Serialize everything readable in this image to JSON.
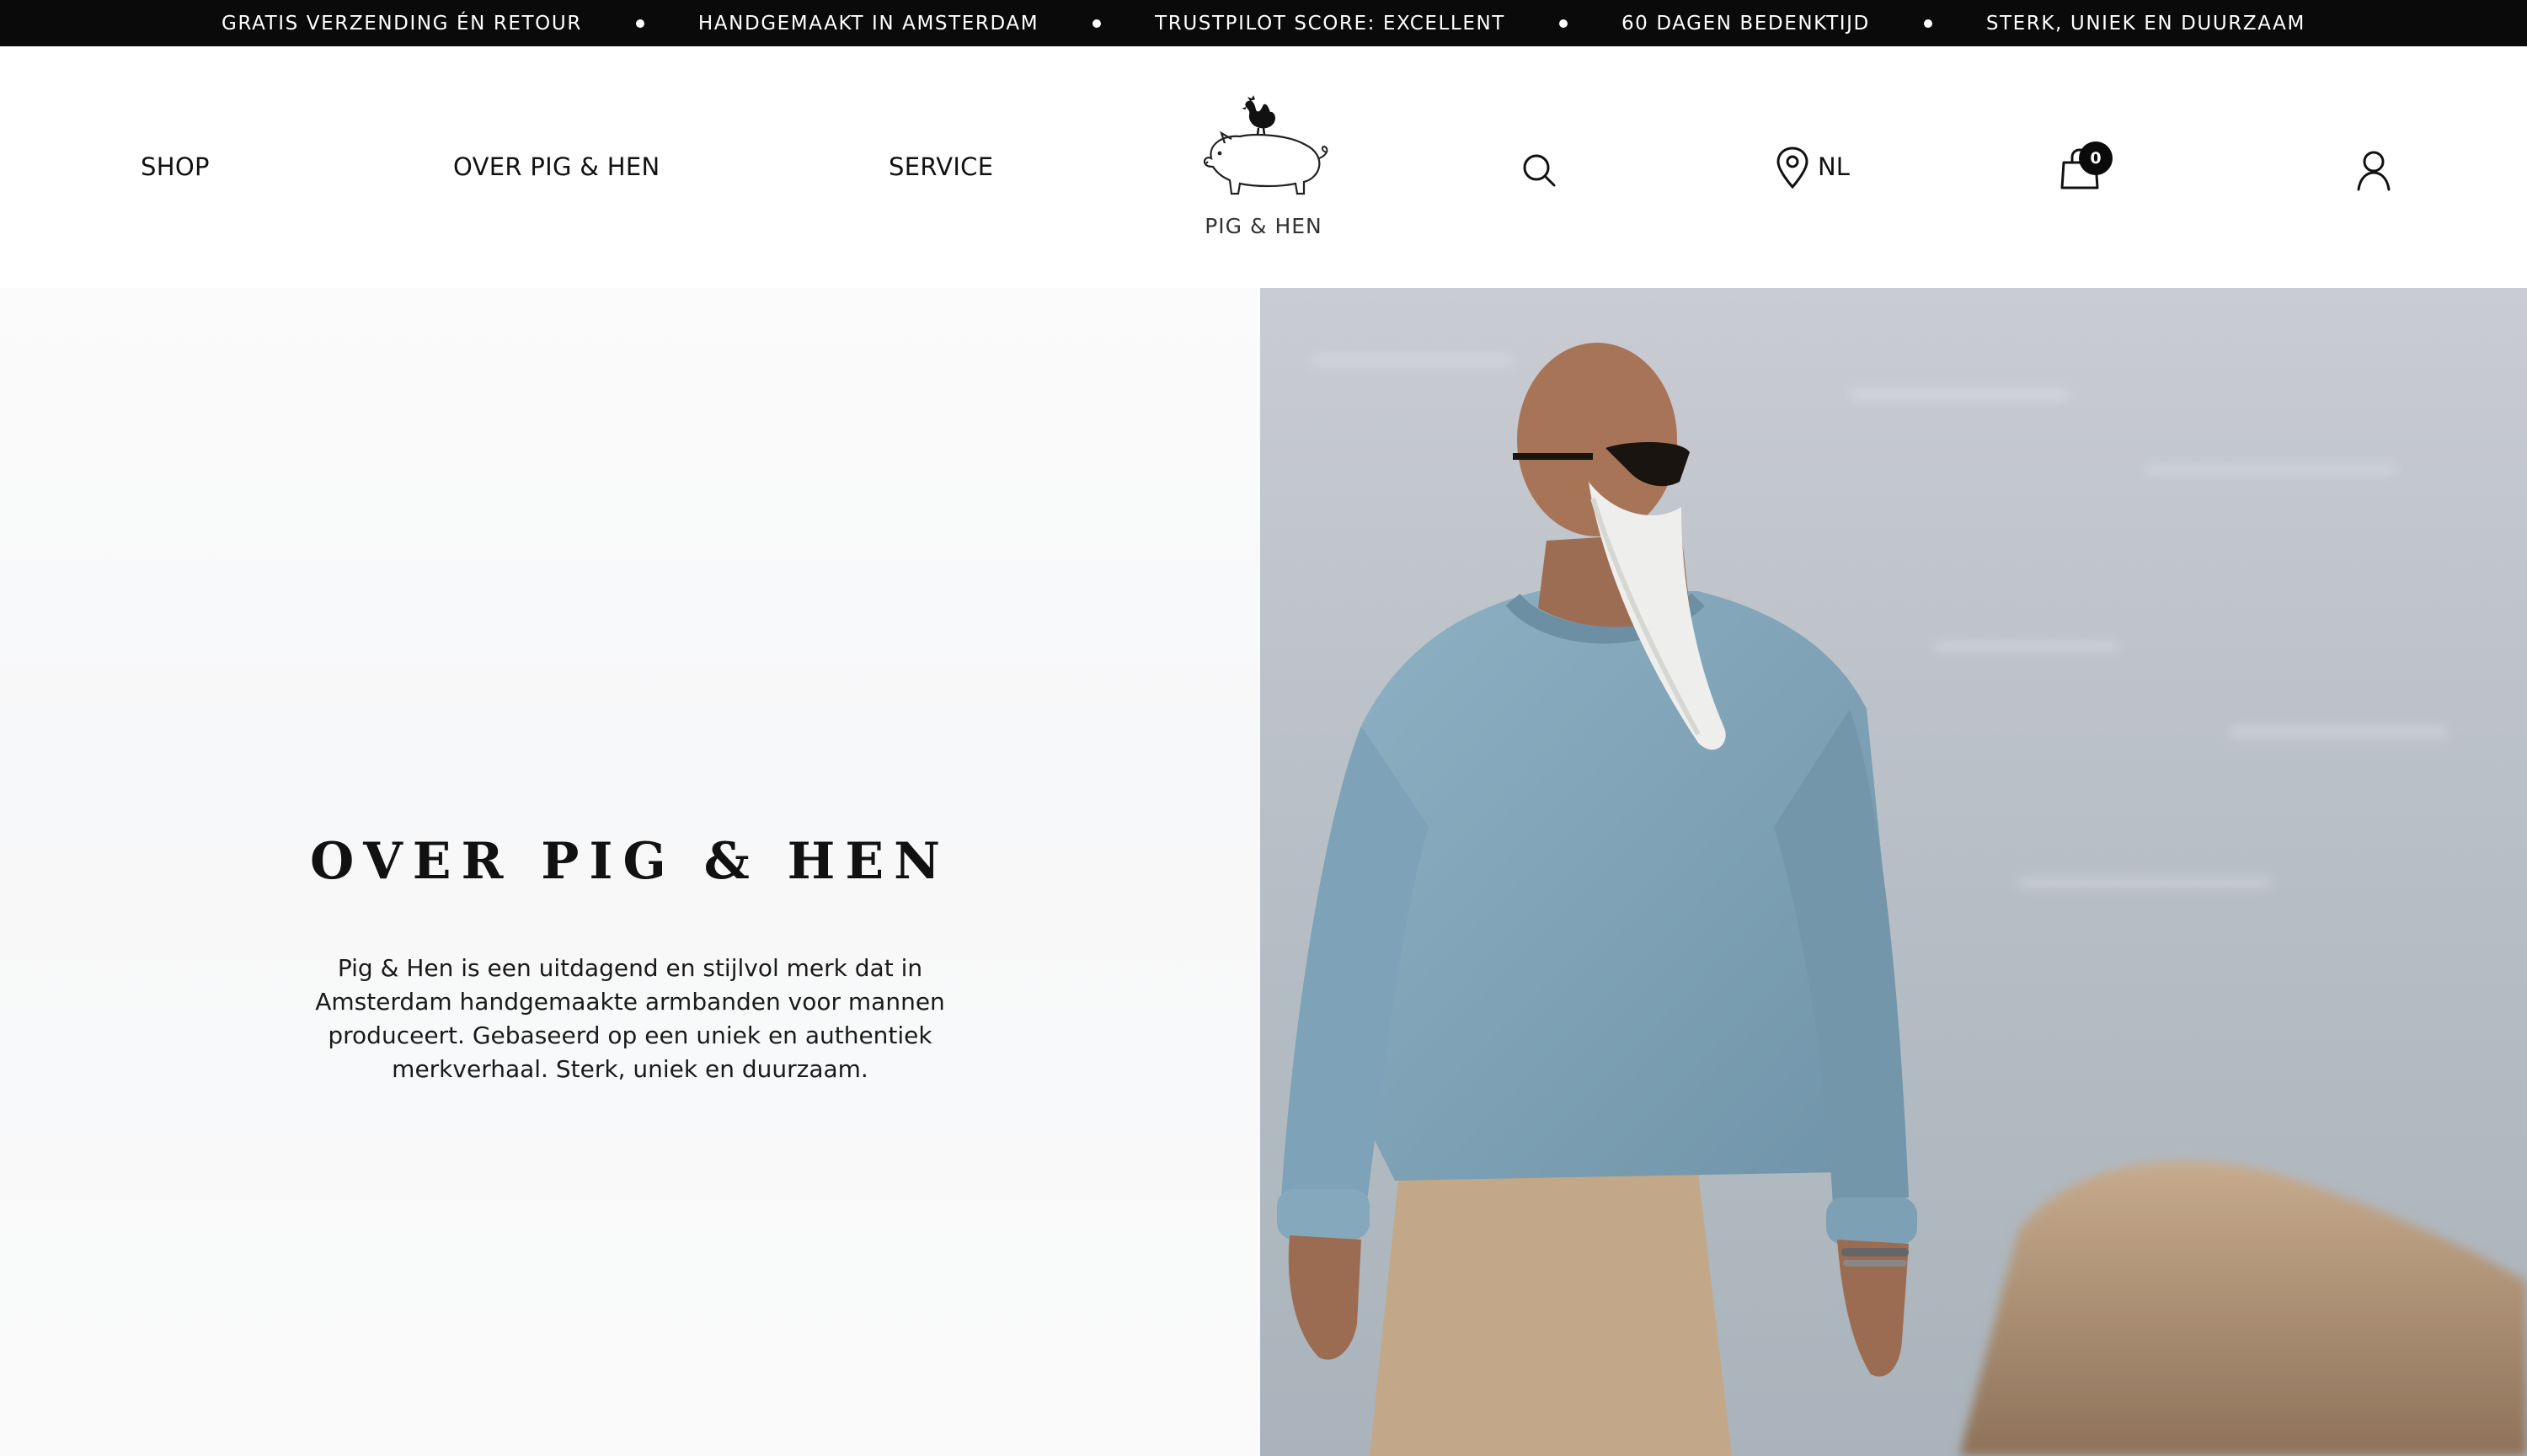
{
  "announcement_bar": {
    "items": [
      "GRATIS VERZENDING ÉN RETOUR",
      "HANDGEMAAKT IN AMSTERDAM",
      "TRUSTPILOT SCORE: EXCELLENT",
      "60 DAGEN BEDENKTIJD",
      "STERK, UNIEK EN DUURZAAM"
    ]
  },
  "nav": {
    "shop": "SHOP",
    "about": "OVER PIG & HEN",
    "service": "SERVICE"
  },
  "logo": {
    "text": "PIG & HEN",
    "icon": "pig-and-hen-logo"
  },
  "header_icons": {
    "search": "search-icon",
    "location": "map-pin-icon",
    "language": "NL",
    "cart": "shopping-bag-icon",
    "cart_count": "0",
    "account": "user-icon"
  },
  "hero": {
    "title": "OVER PIG & HEN",
    "body": "Pig & Hen is een uitdagend en stijlvol merk dat in Amsterdam handgemaakte armbanden voor mannen produceert. Gebaseerd op een uniek en authentiek merkverhaal. Sterk, uniek en duurzaam."
  },
  "colors": {
    "announcement_bg": "#0a0a0a",
    "text": "#111111",
    "sweater": "#7fa3b8",
    "pants": "#c3a88a"
  }
}
